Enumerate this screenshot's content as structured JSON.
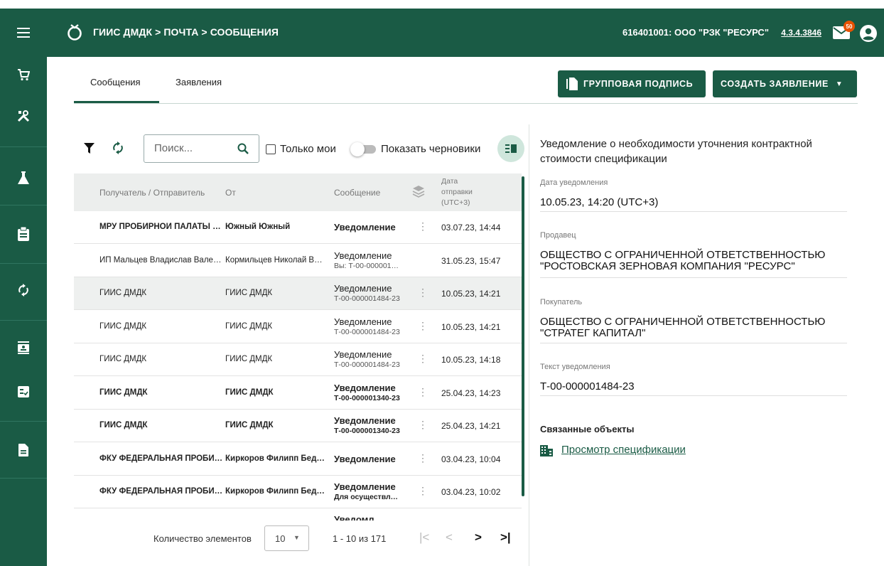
{
  "header": {
    "breadcrumb": "ГИИС ДМДК > ПОЧТА > СООБЩЕНИЯ",
    "org": "616401001: ООО \"РЗК \"РЕСУРС\"",
    "version": "4.3.4.3846",
    "mail_badge": "50",
    "bg_color": "#1a5b45"
  },
  "sidebar": {
    "items": [
      "cart-icon",
      "tools-icon",
      "flask-icon",
      "clipboard-icon",
      "sync-icon",
      "badge-icon",
      "checklist-icon",
      "document-icon"
    ]
  },
  "tabs": [
    {
      "label": "Сообщения",
      "active": true
    },
    {
      "label": "Заявления",
      "active": false
    }
  ],
  "actions": {
    "group_sign": "ГРУППОВАЯ ПОДПИСЬ",
    "create": "СОЗДАТЬ ЗАЯВЛЕНИЕ"
  },
  "toolbar": {
    "search_placeholder": "Поиск...",
    "only_mine": "Только мои",
    "show_drafts": "Показать черновики"
  },
  "table": {
    "columns": [
      "Получатель / Отправитель",
      "От",
      "Сообщение",
      "Дата",
      "отправки",
      "(UTC+3)"
    ],
    "rows": [
      {
        "recipient": "МРУ ПРОБИРНОЙ ПАЛАТЫ ПО ЮЖНОМУ ФЕДЕРАЛЬНОМУ ОКРУГУ",
        "from": "Южный Южный",
        "message": "Уведомление",
        "sub": "",
        "date": "03.07.23, 14:44",
        "bold": true
      },
      {
        "recipient": "ИП Мальцев Владислав Валерьевич",
        "from": "Кормильцев Николай Викторович",
        "message": "Уведомление",
        "sub": "Вы: Т-00-000001484-23",
        "date": "31.05.23, 15:47",
        "bold": false
      },
      {
        "recipient": "ГИИС ДМДК",
        "from": "ГИИС ДМДК",
        "message": "Уведомление",
        "sub": "Т-00-000001484-23",
        "date": "10.05.23, 14:21",
        "bold": false,
        "selected": true
      },
      {
        "recipient": "ГИИС ДМДК",
        "from": "ГИИС ДМДК",
        "message": "Уведомление",
        "sub": "Т-00-000001484-23",
        "date": "10.05.23, 14:21",
        "bold": false
      },
      {
        "recipient": "ГИИС ДМДК",
        "from": "ГИИС ДМДК",
        "message": "Уведомление",
        "sub": "Т-00-000001484-23",
        "date": "10.05.23, 14:18",
        "bold": false
      },
      {
        "recipient": "ГИИС ДМДК",
        "from": "ГИИС ДМДК",
        "message": "Уведомление",
        "sub": "Т-00-000001340-23",
        "date": "25.04.23, 14:23",
        "bold": true
      },
      {
        "recipient": "ГИИС ДМДК",
        "from": "ГИИС ДМДК",
        "message": "Уведомление",
        "sub": "Т-00-000001340-23",
        "date": "25.04.23, 14:21",
        "bold": true
      },
      {
        "recipient": "ФКУ ФЕДЕРАЛЬНАЯ ПРОБИРНАЯ ПАЛАТА",
        "from": "Киркоров Филипп Бедросович",
        "message": "Уведомление",
        "sub": "",
        "date": "03.04.23, 10:04",
        "bold": true
      },
      {
        "recipient": "ФКУ ФЕДЕРАЛЬНАЯ ПРОБИРНАЯ ПАЛАТА",
        "from": "Киркоров Филипп Бедросович",
        "message": "Уведомление",
        "sub": "Для осуществления",
        "date": "03.04.23, 10:02",
        "bold": true
      }
    ],
    "partial_row_message": "Уведомл..."
  },
  "pager": {
    "label": "Количество элементов",
    "page_size": "10",
    "range": "1 - 10 из 171"
  },
  "detail": {
    "title": "Уведомление о необходимости уточнения контрактной стоимости спецификации",
    "date_label": "Дата уведомления",
    "date_value": "10.05.23, 14:20 (UTC+3)",
    "seller_label": "Продавец",
    "seller_value": "ОБЩЕСТВО С ОГРАНИЧЕННОЙ ОТВЕТСТВЕННОСТЬЮ \"РОСТОВСКАЯ ЗЕРНОВАЯ КОМПАНИЯ \"РЕСУРС\"",
    "buyer_label": "Покупатель",
    "buyer_value": "ОБЩЕСТВО С ОГРАНИЧЕННОЙ ОТВЕТСТВЕННОСТЬЮ \"СТРАТЕГ КАПИТАЛ\"",
    "text_label": "Текст уведомления",
    "text_value": "Т-00-000001484-23",
    "related_label": "Связанные объекты",
    "related_link": "Просмотр спецификации"
  }
}
